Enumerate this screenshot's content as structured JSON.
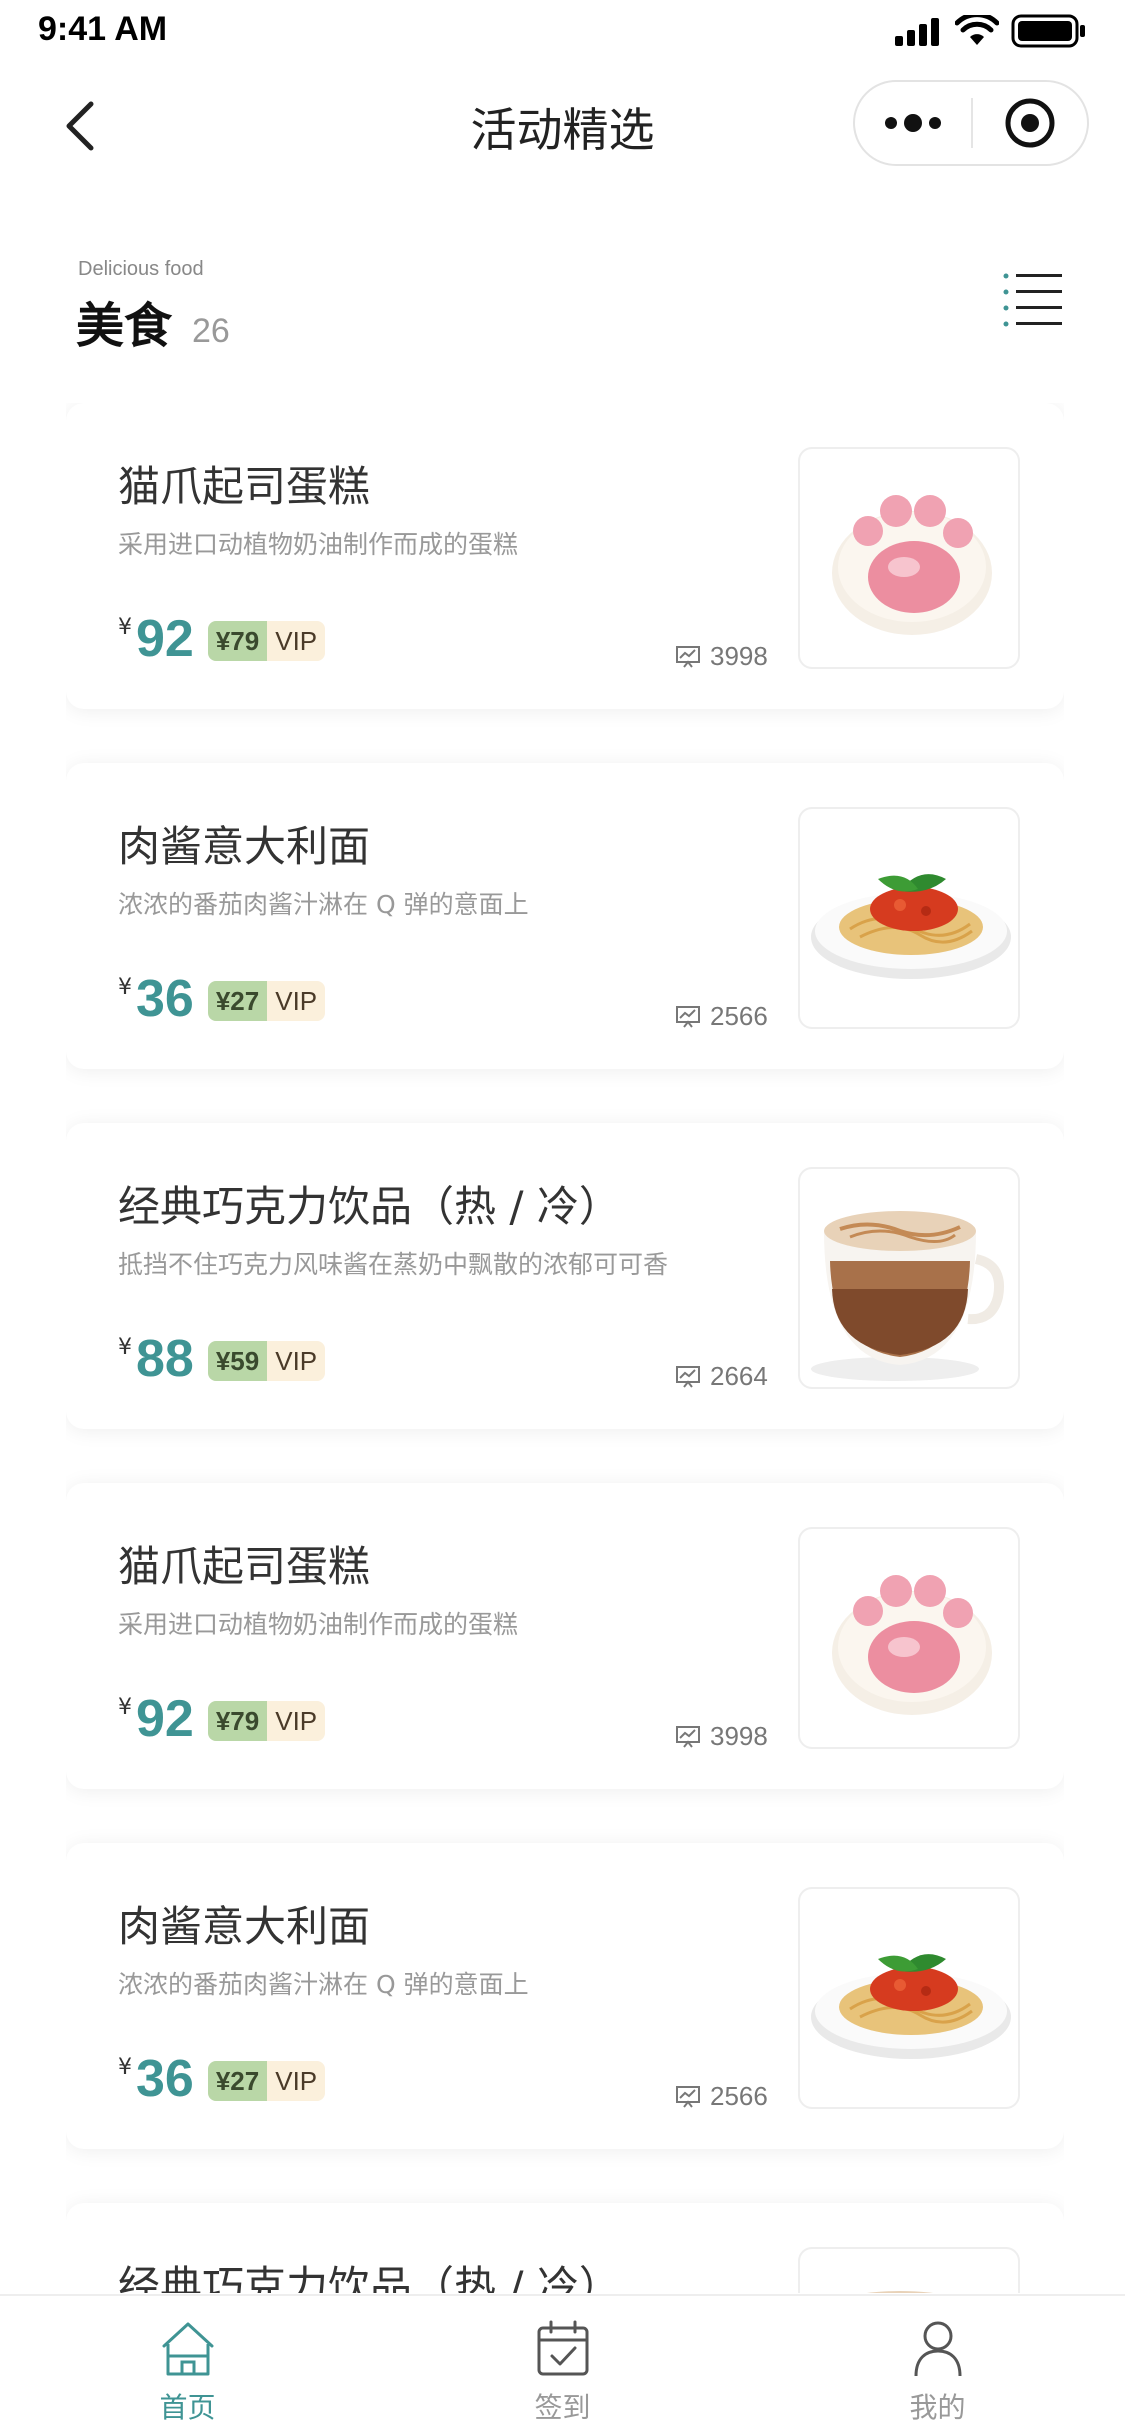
{
  "status_bar": {
    "time": "9:41 AM"
  },
  "nav": {
    "title": "活动精选"
  },
  "section": {
    "subtitle": "Delicious food",
    "title": "美食",
    "count": "26"
  },
  "items": [
    {
      "title": "猫爪起司蛋糕",
      "desc": "采用进口动植物奶油制作而成的蛋糕",
      "yen": "¥",
      "price": "92",
      "vip_price": "¥79",
      "vip_label": "VIP",
      "sales": "3998",
      "image": "paw-cake"
    },
    {
      "title": "肉酱意大利面",
      "desc": "浓浓的番茄肉酱汁淋在 Q 弹的意面上",
      "yen": "¥",
      "price": "36",
      "vip_price": "¥27",
      "vip_label": "VIP",
      "sales": "2566",
      "image": "spaghetti"
    },
    {
      "title": "经典巧克力饮品（热 / 冷）",
      "desc": "抵挡不住巧克力风味酱在蒸奶中飘散的浓郁可可香",
      "yen": "¥",
      "price": "88",
      "vip_price": "¥59",
      "vip_label": "VIP",
      "sales": "2664",
      "image": "chocolate-drink"
    },
    {
      "title": "猫爪起司蛋糕",
      "desc": "采用进口动植物奶油制作而成的蛋糕",
      "yen": "¥",
      "price": "92",
      "vip_price": "¥79",
      "vip_label": "VIP",
      "sales": "3998",
      "image": "paw-cake"
    },
    {
      "title": "肉酱意大利面",
      "desc": "浓浓的番茄肉酱汁淋在 Q 弹的意面上",
      "yen": "¥",
      "price": "36",
      "vip_price": "¥27",
      "vip_label": "VIP",
      "sales": "2566",
      "image": "spaghetti"
    },
    {
      "title": "经典巧克力饮品（热 / 冷）",
      "desc": "",
      "yen": "",
      "price": "",
      "vip_price": "",
      "vip_label": "",
      "sales": "",
      "image": "chocolate-drink"
    }
  ],
  "tabs": [
    {
      "label": "首页",
      "icon": "home-icon",
      "active": true
    },
    {
      "label": "签到",
      "icon": "calendar-check-icon",
      "active": false
    },
    {
      "label": "我的",
      "icon": "user-icon",
      "active": false
    }
  ],
  "colors": {
    "accent": "#3f9494",
    "vip_price_bg": "#b9d7a7",
    "vip_label_bg": "#fbf0dc"
  }
}
